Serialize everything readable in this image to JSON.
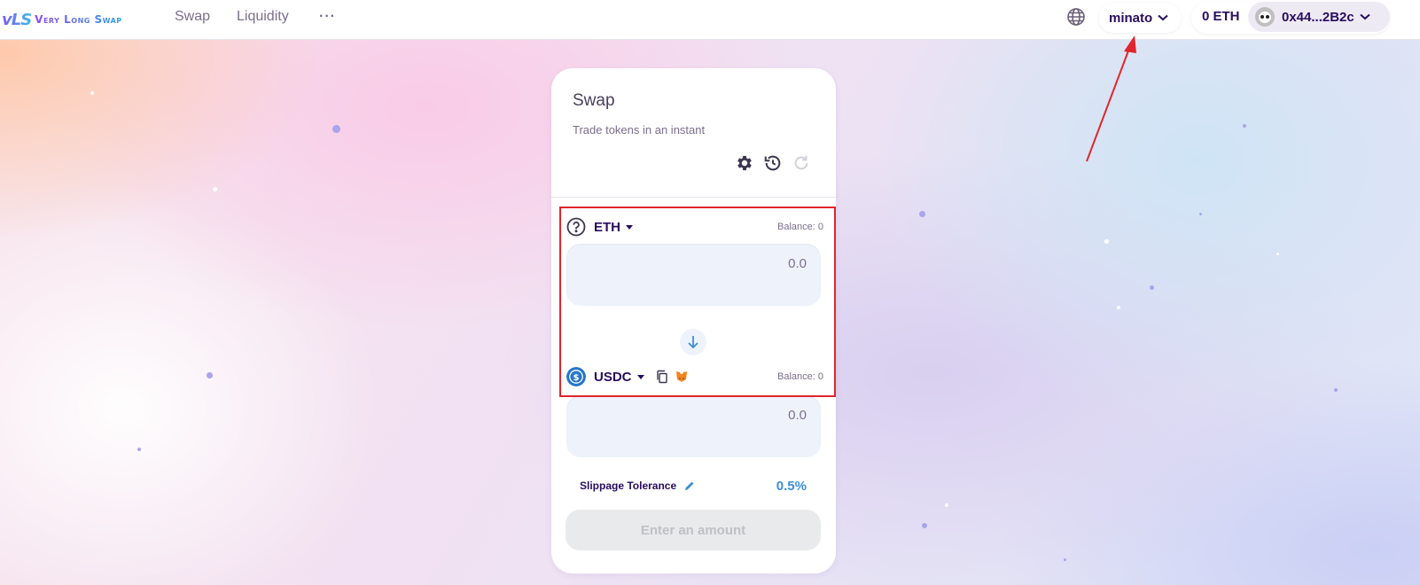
{
  "header": {
    "logo_mark": "vLS",
    "logo_text": "Very Long Swap",
    "nav": [
      {
        "label": "Swap"
      },
      {
        "label": "Liquidity"
      },
      {
        "label": "···"
      }
    ],
    "language_icon": "globe-icon",
    "network": {
      "label": "minato"
    },
    "eth_balance": "0 ETH",
    "account": {
      "address": "0x44...2B2c"
    }
  },
  "swap_card": {
    "title": "Swap",
    "subtitle": "Trade tokens in an instant",
    "toolbar_icons": [
      "gear-icon",
      "history-icon",
      "refresh-icon"
    ],
    "from": {
      "token": "ETH",
      "balance": "Balance: 0",
      "placeholder": "0.0"
    },
    "to": {
      "token": "USDC",
      "balance": "Balance: 0",
      "placeholder": "0.0"
    },
    "slippage": {
      "label": "Slippage Tolerance",
      "value": "0.5%"
    },
    "cta_label": "Enter an amount"
  },
  "colors": {
    "annotation_red": "#e0262b",
    "brand_text": "#280d5f",
    "slippage_blue": "#3b8ed8",
    "usdc_blue": "#2775ca"
  }
}
